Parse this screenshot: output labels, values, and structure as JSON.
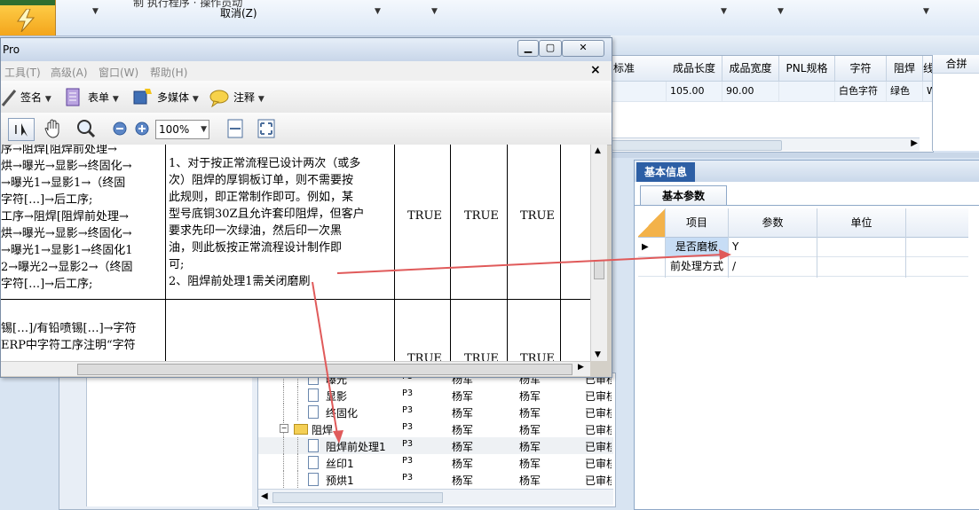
{
  "app": {
    "cancel_label": "取消(Z)",
    "top_truncated_text": "制 执行程序 · 操作员动",
    "standard_header": "标准"
  },
  "right_grid": {
    "headers": [
      "成品长度",
      "成品宽度",
      "PNL规格",
      "字符",
      "阻焊",
      "线"
    ],
    "row": [
      "105.00",
      "90.00",
      "",
      "白色字符",
      "绿色",
      "WO"
    ],
    "merge_header": "合拼"
  },
  "info_panel": {
    "tab": "基本信息",
    "sub_tab": "基本参数",
    "headers": [
      "项目",
      "参数",
      "单位"
    ],
    "rows": [
      {
        "item": "是否磨板",
        "param": "Y",
        "unit": ""
      },
      {
        "item": "前处理方式",
        "param": "/",
        "unit": ""
      }
    ]
  },
  "pdf": {
    "title": "Pro",
    "menu": [
      "工具(T)",
      "高级(A)",
      "窗口(W)",
      "帮助(H)"
    ],
    "toolbar": {
      "sign": "签名",
      "form": "表单",
      "multimedia": "多媒体",
      "comment": "注释",
      "zoom": "100%"
    },
    "doc": {
      "left_lines": [
        "序→阻焊[阻焊前处理→",
        "烘→曝光→显影→终固化→",
        "→曝光1→显影1→（终固",
        "字符[…]→后工序;",
        "工序→阻焊[阻焊前处理→",
        "烘→曝光→显影→终固化→",
        "→曝光1→显影1→终固化1",
        "2→曝光2→显影2→（终固",
        "字符[…]→后工序;"
      ],
      "mid_lines": [
        "1、对于按正常流程已设计两次（或多",
        "次）阻焊的厚铜板订单，则不需要按",
        "此规则，即正常制作即可。例如，某",
        "型号底铜30Z且允许套印阻焊，但客户",
        "要求先印一次绿油，然后印一次黑",
        "油，则此板按正常流程设计制作即",
        "可;",
        "2、阻焊前处理1需关闭磨刷"
      ],
      "bool_values": [
        "TRUE",
        "TRUE",
        "TRUE"
      ],
      "bool_values_2": [
        "TRUE",
        "TRUE",
        "TRUE"
      ],
      "bottom_lines": [
        "锡[…]/有铅喷锡[…]→字符",
        "ERP中字符工序注明“字符"
      ]
    }
  },
  "tree": {
    "rows": [
      {
        "name": "曝光",
        "code": "P3",
        "c1": "杨军",
        "c2": "杨军",
        "status": "已审核",
        "type": "doc",
        "indent": 2
      },
      {
        "name": "显影",
        "code": "P3",
        "c1": "杨军",
        "c2": "杨军",
        "status": "已审核",
        "type": "doc",
        "indent": 2
      },
      {
        "name": "终固化",
        "code": "P3",
        "c1": "杨军",
        "c2": "杨军",
        "status": "已审核",
        "type": "doc",
        "indent": 2
      },
      {
        "name": "阻焊",
        "code": "P3",
        "c1": "杨军",
        "c2": "杨军",
        "status": "已审核",
        "type": "folder",
        "indent": 1
      },
      {
        "name": "阻焊前处理1",
        "code": "P3",
        "c1": "杨军",
        "c2": "杨军",
        "status": "已审核",
        "type": "doc",
        "indent": 2
      },
      {
        "name": "丝印1",
        "code": "P3",
        "c1": "杨军",
        "c2": "杨军",
        "status": "已审核",
        "type": "doc",
        "indent": 2
      },
      {
        "name": "预烘1",
        "code": "P3",
        "c1": "杨军",
        "c2": "杨军",
        "status": "已审核",
        "type": "doc",
        "indent": 2
      }
    ]
  },
  "colors": {
    "accent": "#2d5fa5",
    "annotation_arrow": "#e05a5a"
  }
}
